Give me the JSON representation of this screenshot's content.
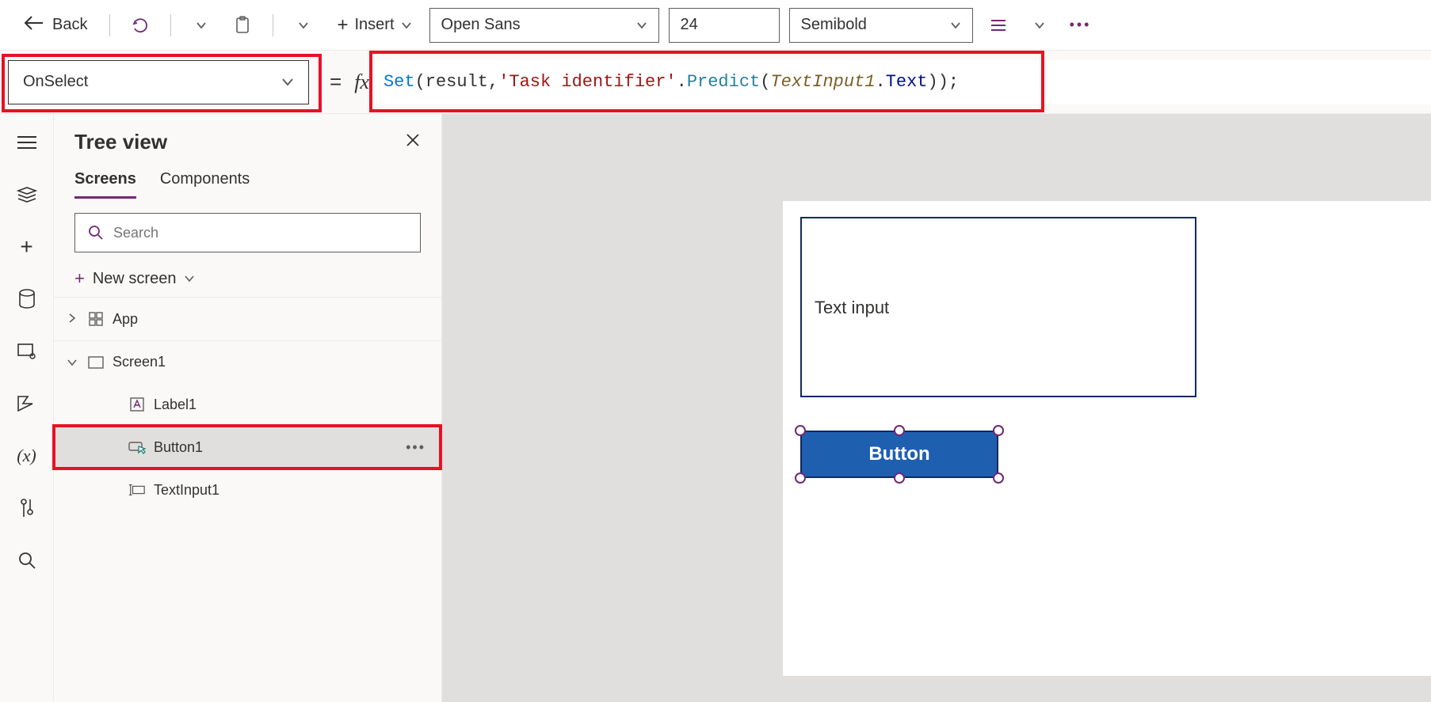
{
  "toolbar": {
    "back_label": "Back",
    "insert_label": "Insert",
    "font_family": "Open Sans",
    "font_size": "24",
    "font_weight": "Semibold"
  },
  "formula_bar": {
    "property": "OnSelect",
    "formula_tokens": {
      "set": "Set",
      "open_paren1": "(",
      "arg1": "result",
      "comma": ", ",
      "str": "'Task identifier'",
      "dot1": ".",
      "predict": "Predict",
      "open_paren2": "(",
      "obj": "TextInput1",
      "dot2": ".",
      "text": "Text",
      "close": "));"
    }
  },
  "tree": {
    "title": "Tree view",
    "tabs": {
      "screens": "Screens",
      "components": "Components"
    },
    "search_placeholder": "Search",
    "new_screen": "New screen",
    "items": {
      "app": "App",
      "screen1": "Screen1",
      "label1": "Label1",
      "button1": "Button1",
      "textinput1": "TextInput1"
    }
  },
  "canvas": {
    "text_input_value": "Text input",
    "button_label": "Button"
  }
}
